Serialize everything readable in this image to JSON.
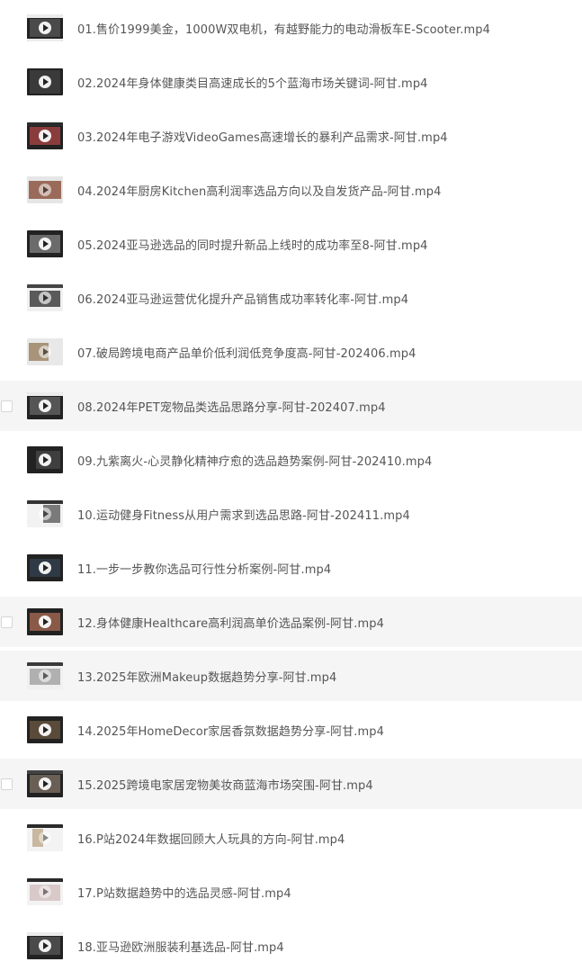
{
  "files": [
    {
      "name": "01.售价1999美金，1000W双电机，有越野能力的电动滑板车E-Scooter.mp4",
      "icon": "video-thumbnail",
      "highlighted": false,
      "checkbox": false
    },
    {
      "name": "02.2024年身体健康类目高速成长的5个蓝海市场关键词-阿甘.mp4",
      "icon": "video-thumbnail",
      "highlighted": false,
      "checkbox": false
    },
    {
      "name": "03.2024年电子游戏VideoGames高速增长的暴利产品需求-阿甘.mp4",
      "icon": "video-thumbnail",
      "highlighted": false,
      "checkbox": false
    },
    {
      "name": "04.2024年厨房Kitchen高利润率选品方向以及自发货产品-阿甘.mp4",
      "icon": "video-thumbnail",
      "highlighted": false,
      "checkbox": false
    },
    {
      "name": "05.2024亚马逊选品的同时提升新品上线时的成功率至8-阿甘.mp4",
      "icon": "video-thumbnail",
      "highlighted": false,
      "checkbox": false
    },
    {
      "name": "06.2024亚马逊运营优化提升产品销售成功率转化率-阿甘.mp4",
      "icon": "video-thumbnail",
      "highlighted": false,
      "checkbox": false
    },
    {
      "name": "07.破局跨境电商产品单价低利润低竞争度高-阿甘-202406.mp4",
      "icon": "video-thumbnail",
      "highlighted": false,
      "checkbox": false
    },
    {
      "name": "08.2024年PET宠物品类选品思路分享-阿甘-202407.mp4",
      "icon": "video-thumbnail",
      "highlighted": true,
      "checkbox": true
    },
    {
      "name": "09.九紫离火-心灵静化精神疗愈的选品趋势案例-阿甘-202410.mp4",
      "icon": "video-thumbnail",
      "highlighted": false,
      "checkbox": false
    },
    {
      "name": "10.运动健身Fitness从用户需求到选品思路-阿甘-202411.mp4",
      "icon": "video-thumbnail",
      "highlighted": false,
      "checkbox": false
    },
    {
      "name": "11.一步一步教你选品可行性分析案例-阿甘.mp4",
      "icon": "video-thumbnail",
      "highlighted": false,
      "checkbox": false
    },
    {
      "name": "12.身体健康Healthcare高利润高单价选品案例-阿甘.mp4",
      "icon": "video-thumbnail",
      "highlighted": true,
      "checkbox": true
    },
    {
      "name": "13.2025年欧洲Makeup数据趋势分享-阿甘.mp4",
      "icon": "video-thumbnail",
      "highlighted": true,
      "checkbox": false
    },
    {
      "name": "14.2025年HomeDecor家居香氛数据趋势分享-阿甘.mp4",
      "icon": "video-thumbnail",
      "highlighted": false,
      "checkbox": false
    },
    {
      "name": "15.2025跨境电家居宠物美妆商蓝海市场突围-阿甘.mp4",
      "icon": "video-thumbnail",
      "highlighted": true,
      "checkbox": true
    },
    {
      "name": "16.P站2024年数据回顾大人玩具的方向-阿甘.mp4",
      "icon": "video-thumbnail",
      "highlighted": false,
      "checkbox": false
    },
    {
      "name": "17.P站数据趋势中的选品灵感-阿甘.mp4",
      "icon": "video-thumbnail",
      "highlighted": false,
      "checkbox": false
    },
    {
      "name": "18.亚马逊欧洲服装利基选品-阿甘.mp4",
      "icon": "video-thumbnail",
      "highlighted": false,
      "checkbox": false
    }
  ]
}
